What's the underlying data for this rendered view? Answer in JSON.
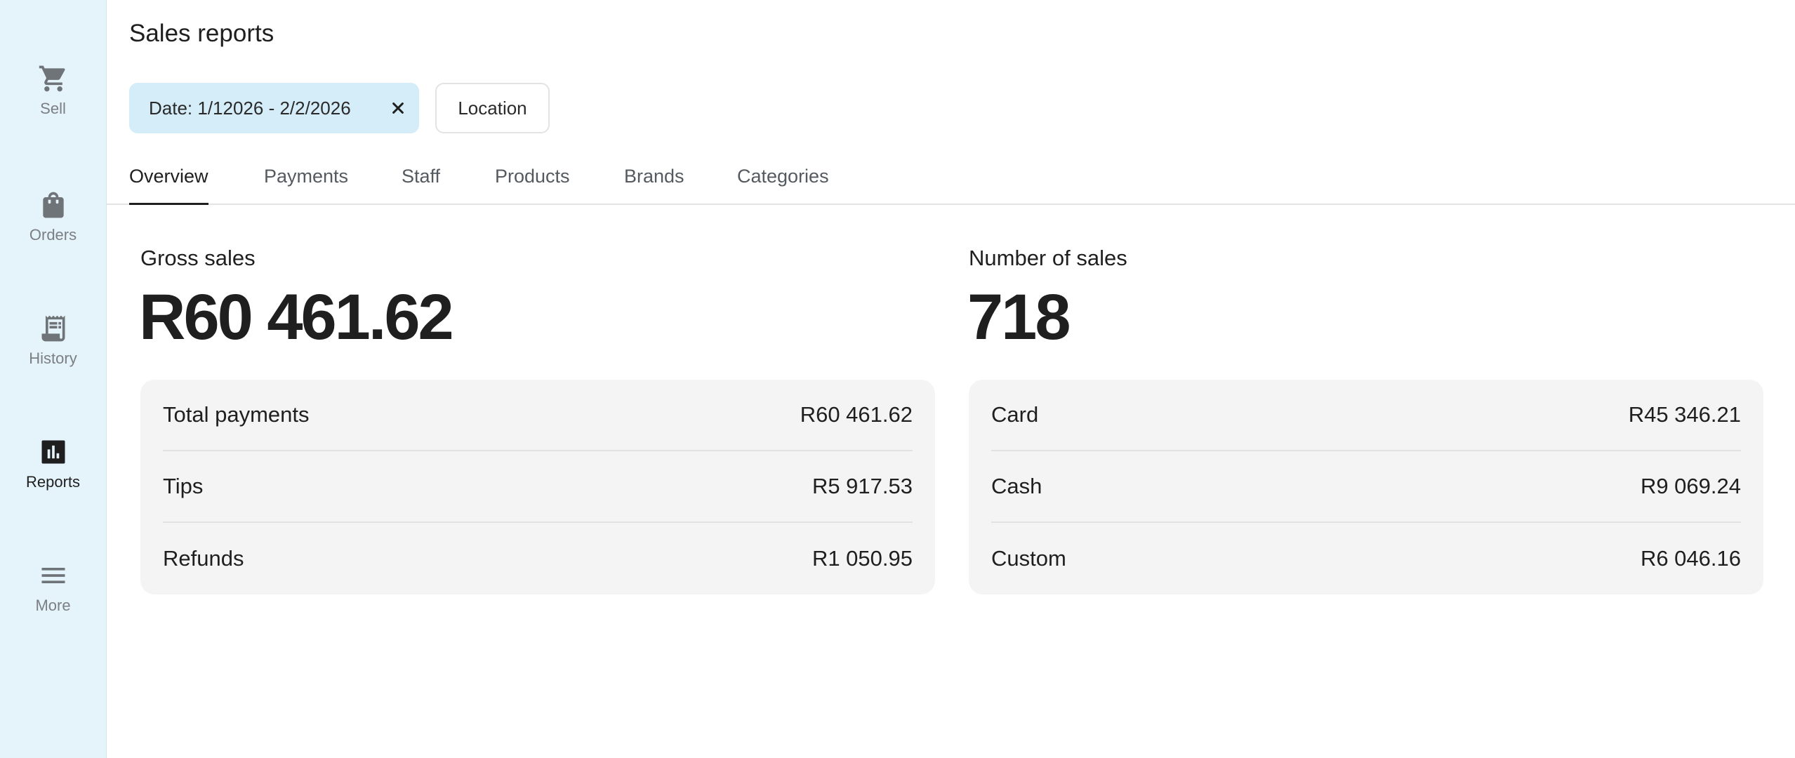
{
  "sidebar": {
    "items": [
      {
        "label": "Sell",
        "icon": "cart-icon"
      },
      {
        "label": "Orders",
        "icon": "shopping-bag-icon"
      },
      {
        "label": "History",
        "icon": "receipt-icon"
      },
      {
        "label": "Reports",
        "icon": "bar-chart-icon",
        "active": true
      },
      {
        "label": "More",
        "icon": "menu-icon"
      }
    ]
  },
  "header": {
    "title": "Sales reports"
  },
  "filters": {
    "date": "Date: 1/12026 - 2/2/2026",
    "location": "Location"
  },
  "tabs": [
    {
      "label": "Overview",
      "active": true
    },
    {
      "label": "Payments"
    },
    {
      "label": "Staff"
    },
    {
      "label": "Products"
    },
    {
      "label": "Brands"
    },
    {
      "label": "Categories"
    }
  ],
  "gross_sales": {
    "label": "Gross sales",
    "value": "R60 461.62",
    "rows": [
      {
        "label": "Total payments",
        "value": "R60 461.62"
      },
      {
        "label": "Tips",
        "value": "R5 917.53"
      },
      {
        "label": "Refunds",
        "value": "R1 050.95"
      }
    ]
  },
  "number_of_sales": {
    "label": "Number of sales",
    "value": "718",
    "rows": [
      {
        "label": "Card",
        "value": "R45 346.21"
      },
      {
        "label": "Cash",
        "value": "R9 069.24"
      },
      {
        "label": "Custom",
        "value": "R6 046.16"
      }
    ]
  },
  "colors": {
    "sidebar_bg": "#e5f3fa",
    "date_chip_bg": "#d5edf8",
    "card_bg": "#f4f4f4",
    "text_primary": "#1f1f1f",
    "text_muted": "#7b7f84"
  }
}
